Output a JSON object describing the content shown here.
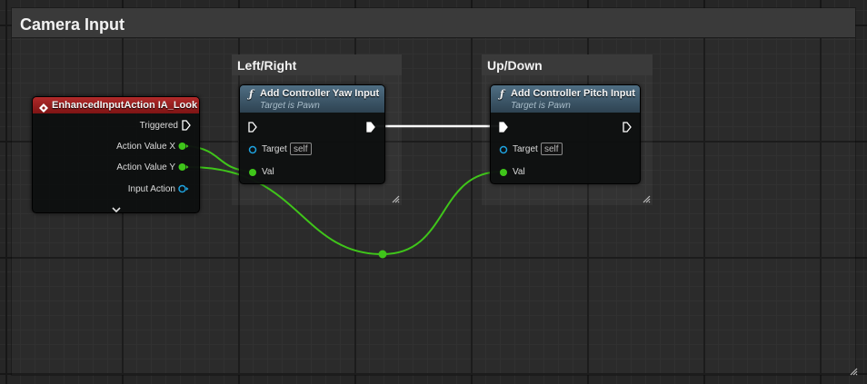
{
  "comments": {
    "main_title": "Camera Input",
    "left_right_title": "Left/Right",
    "up_down_title": "Up/Down"
  },
  "event_node": {
    "title": "EnhancedInputAction IA_Look",
    "pins": {
      "triggered": "Triggered",
      "action_value_x": "Action Value X",
      "action_value_y": "Action Value Y",
      "input_action": "Input Action"
    }
  },
  "yaw_node": {
    "title": "Add Controller Yaw Input",
    "subtitle": "Target is Pawn",
    "target_label": "Target",
    "target_value": "self",
    "val_label": "Val"
  },
  "pitch_node": {
    "title": "Add Controller Pitch Input",
    "subtitle": "Target is Pawn",
    "target_label": "Target",
    "target_value": "self",
    "val_label": "Val"
  },
  "icons": {
    "event": "event-diamond-icon",
    "function": "function-f-icon",
    "expand": "chevron-down-icon",
    "resize": "resize-grip-icon"
  },
  "colors": {
    "float_pin": "#3fc51a",
    "object_pin": "#1ea3e0",
    "exec_pin": "#ffffff",
    "event_header": "#9a1f1f",
    "function_header": "#435d70"
  }
}
